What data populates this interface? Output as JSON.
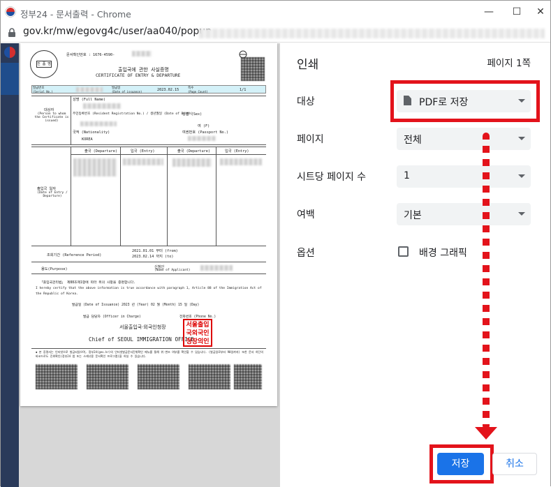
{
  "window": {
    "title": "정부24 - 문서출력 - Chrome",
    "url": "gov.kr/mw/egovg4c/user/aa040/popup"
  },
  "document": {
    "doc_number_label": "문서확인번호 : 1676-4590-",
    "title_ko": "출입국에 관한 사실증명",
    "title_en": "CERTIFICATE OF ENTRY & DEPARTURE",
    "issue_no_label": "발급번호",
    "issue_no_label_en": "(Serial No.)",
    "issue_date_label": "발급일",
    "issue_date_label_en": "(Date of issuance)",
    "issue_date": "2023.02.15",
    "page_label": "쪽수",
    "page_label_en": "(Page Count)",
    "page_value": "1/1",
    "subject_label": "대상자",
    "subject_label_en": "(Person to whom the Certificate is issued)",
    "name_label": "성명 (Full Name)",
    "reg_label": "주민등록번호 (Resident Registration No.) / 생년월일 (Date of Birth)",
    "sex_label": "성별 (Sex)",
    "sex_value": "여 (F)",
    "nationality_label": "국적 (Nationality)",
    "nationality_value": "KOREA",
    "passport_label": "여권번호 (Passport No.)",
    "departure_label": "출국 (Departure)",
    "entry_label": "입국 (Entry)",
    "dates_label": "출입국 일자",
    "dates_label_en": "(Date of Entry / Departure)",
    "period_label": "조회기간 (Reference Period)",
    "period_from": "2021.01.01 부터 (from)",
    "period_to": "2023.02.14 까지 (to)",
    "purpose_label": "용도(Purpose)",
    "applicant_label": "신청인",
    "applicant_label_en": "(Name of Applicant)",
    "cert_text_ko": "「출입국관리법」 제88조제1항에 따라 위의 사항을 증명합니다.",
    "cert_text_en": "I hereby certify that the above information is true accordance with paragraph 1, Article 88 of the Immigration Act of the Republic of Korea.",
    "issuance_line": "발급일 (Date of Issuance)      2023 년 (Year)   02 월 (Month)   15 일 (Day)",
    "officer_line": "발급 담당자 (Officer in Charge)",
    "phone_label": "전화번호 (Phone No.)",
    "office_ko": "서울출입국·외국인청장",
    "office_en": "Chief of SEOUL IMMIGRATION OFFICE",
    "stamp_text": "서울출입\n국외국인\n청장의인",
    "seal_text": "진 품 명",
    "footnote": "◆ 본 증명서는 인터넷으로 발급되었으며, 정부24(gov.kr)의 인터넷발급문서진위확인 메뉴를 통해 위·변조 여부를 확인할 수 있습니다. (발급일로부터 90일까지) 또한 문서 하단의 바코드로도 진위확인(정부24 앱 또는 스캐너용 문서확인 프로그램)을 하실 수 있습니다."
  },
  "print_panel": {
    "title": "인쇄",
    "page_count": "페이지 1쪽",
    "destination_label": "대상",
    "destination_value": "PDF로 저장",
    "pages_label": "페이지",
    "pages_value": "전체",
    "pages_per_sheet_label": "시트당 페이지 수",
    "pages_per_sheet_value": "1",
    "margins_label": "여백",
    "margins_value": "기본",
    "options_label": "옵션",
    "background_graphics_label": "배경 그래픽",
    "background_graphics_checked": false,
    "save_label": "저장",
    "cancel_label": "취소"
  },
  "annotations": {
    "highlight_color": "#e3131b",
    "arrow_description": "dotted-red-arrow-down"
  },
  "colors": {
    "save_button": "#1a73e8",
    "select_bg": "#f1f3f4",
    "preview_bg": "#d7d7d7"
  }
}
